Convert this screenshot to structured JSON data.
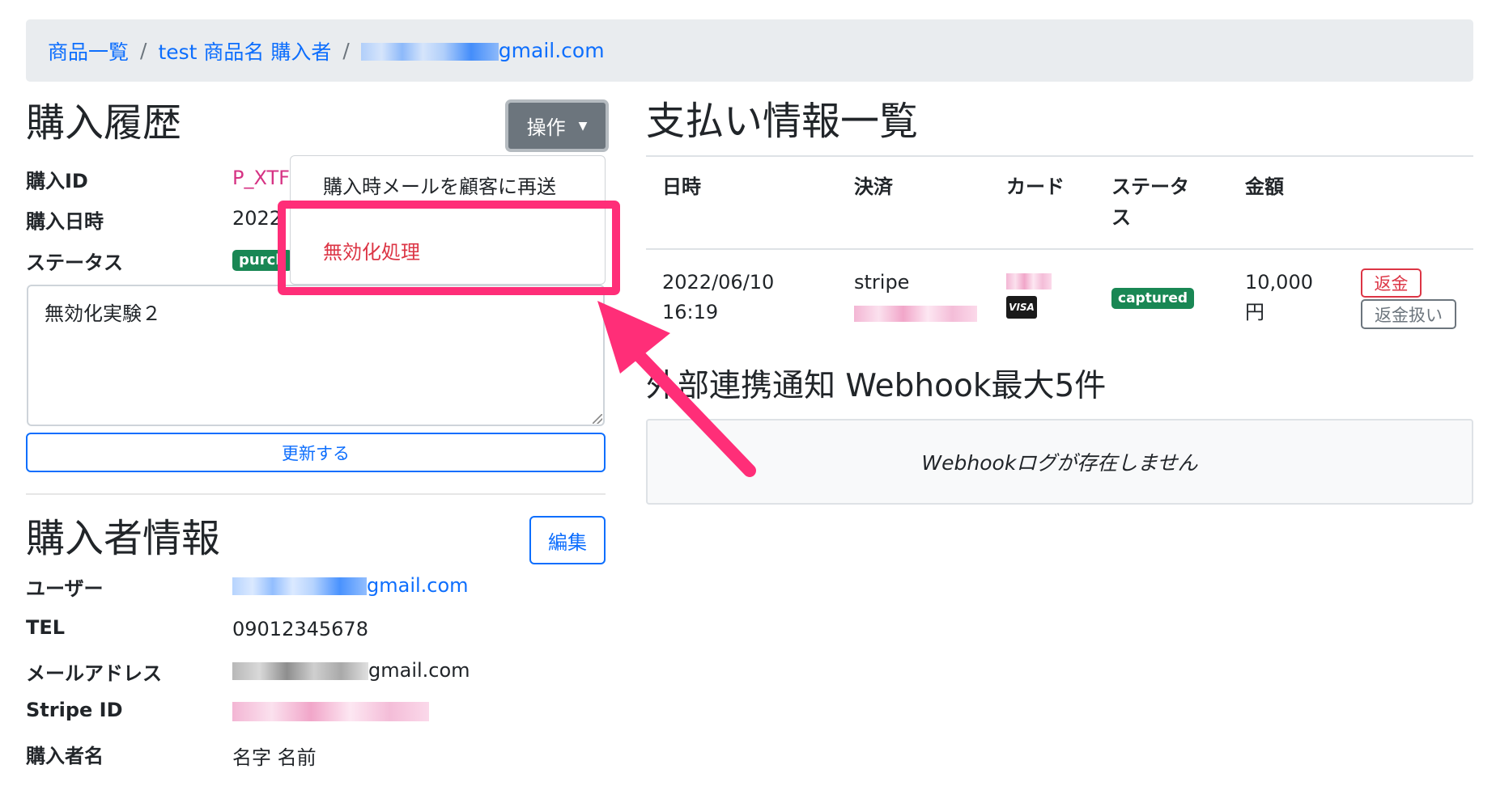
{
  "breadcrumb": {
    "items": [
      "商品一覧",
      "test 商品名 購入者"
    ],
    "email_suffix": "gmail.com",
    "separator": "/"
  },
  "purchase": {
    "title": "購入履歴",
    "ops_button": "操作",
    "fields": [
      {
        "label": "購入ID",
        "value": "P_XTFZ"
      },
      {
        "label": "購入日時",
        "value": "2022"
      },
      {
        "label": "ステータス",
        "value": "purch"
      }
    ],
    "memo": "無効化実験２",
    "update_button": "更新する"
  },
  "dropdown": {
    "items": [
      "購入時メールを顧客に再送",
      "無効化処理"
    ]
  },
  "buyer": {
    "title": "購入者情報",
    "edit_button": "編集",
    "fields": [
      {
        "label": "ユーザー",
        "value": "gmail.com"
      },
      {
        "label": "TEL",
        "value": "09012345678"
      },
      {
        "label": "メールアドレス",
        "value": "gmail.com"
      },
      {
        "label": "Stripe ID",
        "value": ""
      },
      {
        "label": "購入者名",
        "value": "名字 名前"
      }
    ]
  },
  "payments": {
    "title": "支払い情報一覧",
    "headers": [
      "日時",
      "決済",
      "カード",
      "ステータ",
      "ス",
      "金額"
    ],
    "row": {
      "date": "2022/06/10",
      "time": "16:19",
      "method": "stripe",
      "card_brand": "VISA",
      "status": "captured",
      "amount": "10,000",
      "currency": "円",
      "refund": "返金",
      "refund_mark": "返金扱い"
    }
  },
  "webhook": {
    "title": "外部連携通知 Webhook最大5件",
    "empty": "Webhookログが存在しません"
  },
  "colors": {
    "accent": "#0d6efd",
    "danger": "#dc3545",
    "highlight": "#ff2e78",
    "success": "#198754"
  }
}
